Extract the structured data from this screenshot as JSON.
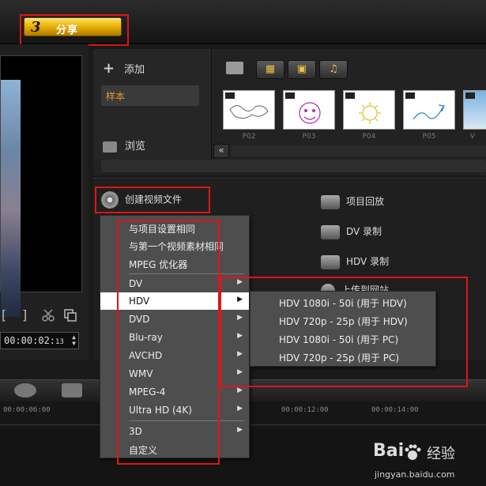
{
  "header": {
    "step_number": "3",
    "step_label": "分享"
  },
  "preview": {
    "controls": [
      "[",
      "]"
    ],
    "timecode_main": "00:00:02:",
    "timecode_frame": "13"
  },
  "library": {
    "add_label": "添加",
    "folder_label": "样本",
    "browse_label": "浏览",
    "collapse_glyph": "«",
    "thumbs": [
      {
        "label": "P02"
      },
      {
        "label": "P03"
      },
      {
        "label": "P04"
      },
      {
        "label": "P05"
      },
      {
        "label": "V"
      }
    ]
  },
  "share": {
    "create_video": "创建视频文件",
    "project_playback": "项目回放",
    "dv_record": "DV 录制",
    "hdv_record": "HDV 录制",
    "upload_web": "上传到网站"
  },
  "menu": {
    "items": [
      {
        "label": "与项目设置相同",
        "has_sub": false
      },
      {
        "label": "与第一个视频素材相同",
        "has_sub": false
      },
      {
        "label": "MPEG 优化器",
        "has_sub": false
      },
      {
        "label": "DV",
        "has_sub": true
      },
      {
        "label": "HDV",
        "has_sub": true,
        "selected": true
      },
      {
        "label": "DVD",
        "has_sub": true
      },
      {
        "label": "Blu-ray",
        "has_sub": true
      },
      {
        "label": "AVCHD",
        "has_sub": true
      },
      {
        "label": "WMV",
        "has_sub": true
      },
      {
        "label": "MPEG-4",
        "has_sub": true
      },
      {
        "label": "Ultra HD (4K)",
        "has_sub": true
      },
      {
        "label": "3D",
        "has_sub": true
      },
      {
        "label": "自定义",
        "has_sub": false
      }
    ],
    "arrow_glyph": "▶"
  },
  "submenu": {
    "items": [
      "HDV 1080i - 50i  (用于 HDV)",
      "HDV 720p - 25p  (用于 HDV)",
      "HDV 1080i - 50i  (用于 PC)",
      "HDV 720p - 25p  (用于 PC)"
    ]
  },
  "timeline": {
    "ruler": [
      "00:00:06:00",
      "00:00:12:00",
      "00:00:14:00"
    ]
  },
  "watermark": {
    "brand": "Bai",
    "brand2": "经验",
    "url": "jingyan.baidu.com"
  },
  "colors": {
    "accent_gold": "#e3a800",
    "highlight_red": "#e0141a",
    "menu_bg": "#4e4e4e"
  }
}
